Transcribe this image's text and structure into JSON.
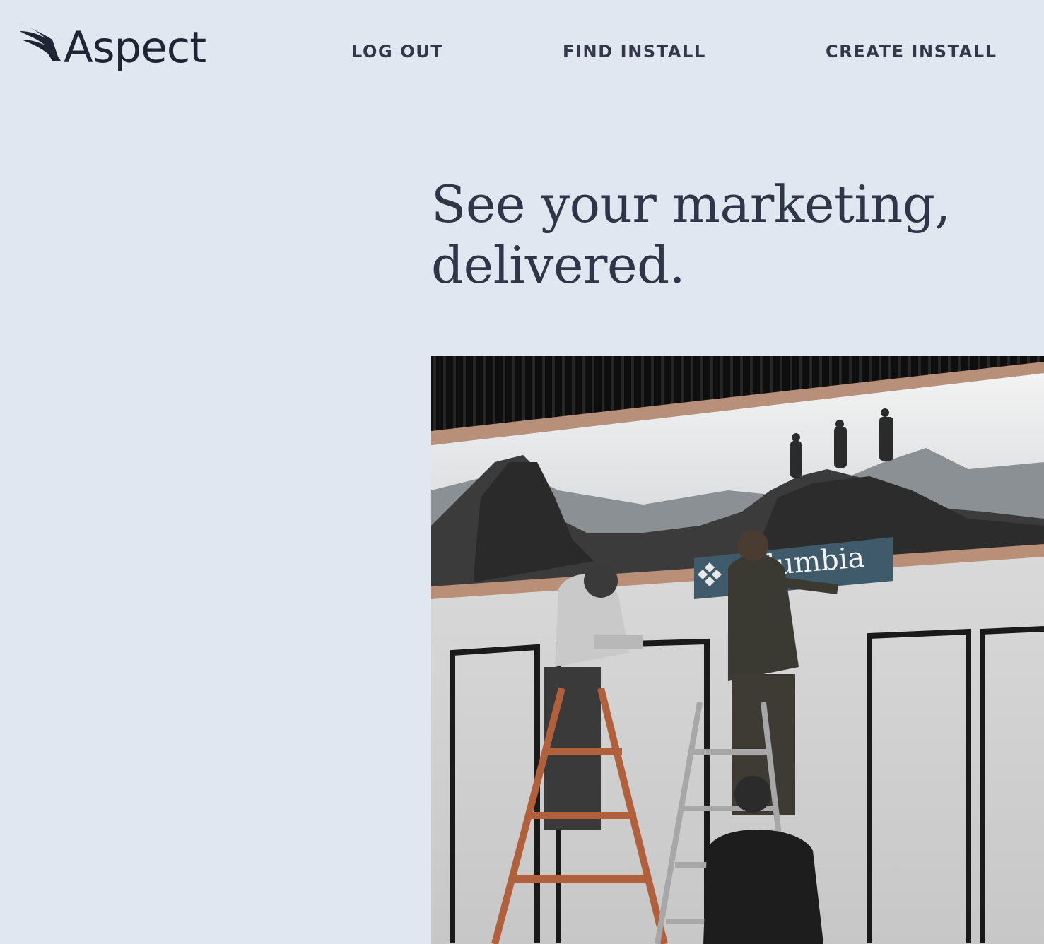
{
  "header": {
    "logo": {
      "text": "Aspect",
      "icon": "wing-icon"
    },
    "nav": [
      {
        "label": "LOG OUT"
      },
      {
        "label": "FIND INSTALL"
      },
      {
        "label": "CREATE INSTALL"
      }
    ]
  },
  "hero": {
    "headline_line1": "See your marketing,",
    "headline_line2": "delivered.",
    "photo": {
      "sign_text": "olumbia"
    }
  },
  "colors": {
    "background": "#e1e7f0",
    "text": "#2e3648",
    "nav_text": "#30384a",
    "sign": "#3f5a6a"
  }
}
